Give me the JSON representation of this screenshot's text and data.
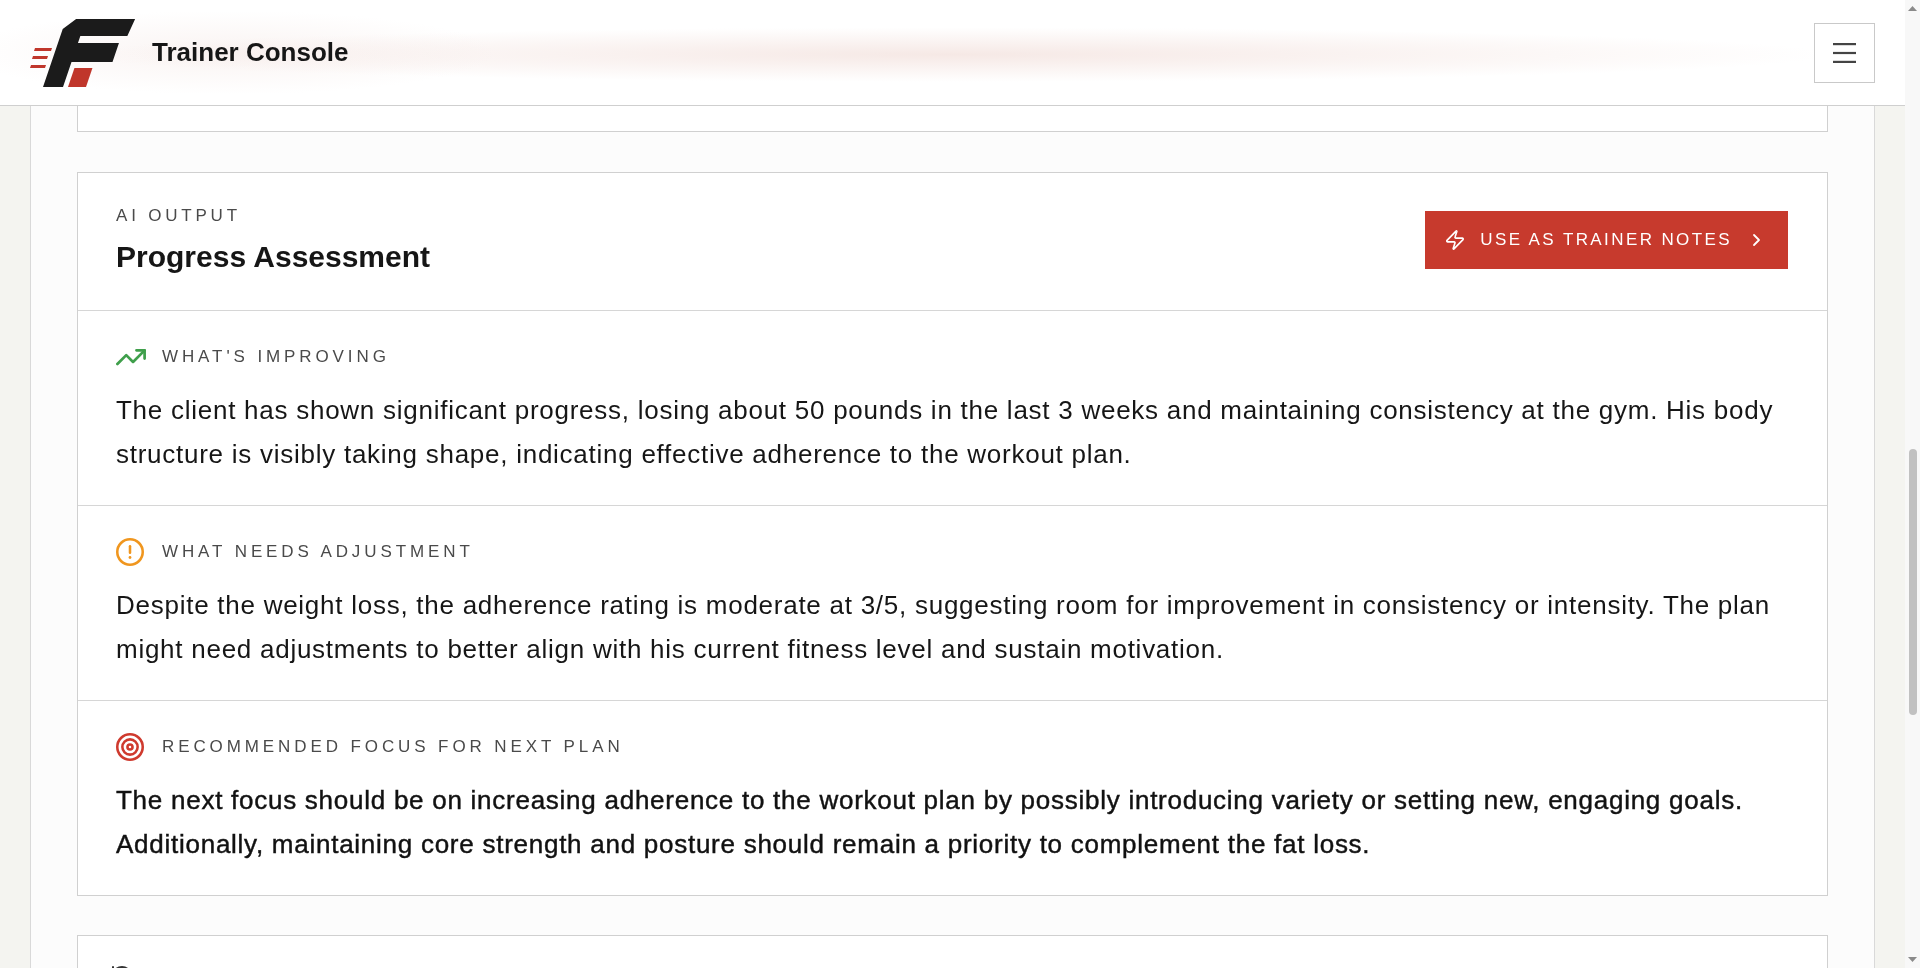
{
  "header": {
    "title": "Trainer Console"
  },
  "assessment": {
    "eyebrow": "AI OUTPUT",
    "title": "Progress Assessment",
    "action": {
      "label": "USE AS TRAINER NOTES"
    },
    "sections": [
      {
        "kind": "positive",
        "heading": "WHAT'S IMPROVING",
        "body": "The client has shown significant progress, losing about 50 pounds in the last 3 weeks and maintaining consistency at the gym. His body structure is visibly taking shape, indicating effective adherence to the workout plan."
      },
      {
        "kind": "warning",
        "heading": "WHAT NEEDS ADJUSTMENT",
        "body": "Despite the weight loss, the adherence rating is moderate at 3/5, suggesting room for improvement in consistency or intensity. The plan might need adjustments to better align with his current fitness level and sustain motivation."
      },
      {
        "kind": "focus",
        "heading": "RECOMMENDED FOCUS FOR NEXT PLAN",
        "body": "The next focus should be on increasing adherence to the workout plan by possibly introducing variety or setting new, engaging goals. Additionally, maintaining core strength and posture should remain a priority to complement the fat loss."
      }
    ]
  }
}
